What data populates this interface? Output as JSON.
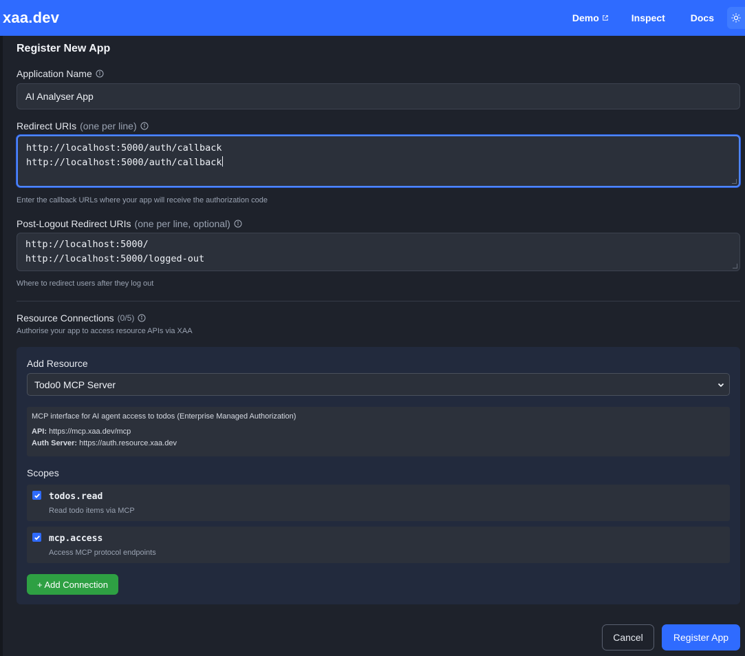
{
  "header": {
    "brand": "xaa.dev",
    "nav": [
      {
        "label": "Demo",
        "external": true
      },
      {
        "label": "Inspect"
      },
      {
        "label": "Docs"
      }
    ],
    "theme_toggle_icon": "sun-icon"
  },
  "form": {
    "title": "Register New App",
    "app_name": {
      "label": "Application Name",
      "value": "AI Analyser App"
    },
    "redirect_uris": {
      "label": "Redirect URIs",
      "hint": "(one per line)",
      "lines": [
        "http://localhost:5000/auth/callback",
        "http://localhost:5000/auth/callback"
      ],
      "help": "Enter the callback URLs where your app will receive the authorization code"
    },
    "post_logout": {
      "label": "Post-Logout Redirect URIs",
      "hint": "(one per line, optional)",
      "lines": [
        "http://localhost:5000/",
        "http://localhost:5000/logged-out"
      ],
      "help": "Where to redirect users after they log out"
    },
    "resources": {
      "label": "Resource Connections",
      "count": "(0/5)",
      "subtitle": "Authorise your app to access resource APIs via XAA",
      "add_resource_label": "Add Resource",
      "selected_resource": "Todo0 MCP Server",
      "description": "MCP interface for AI agent access to todos (Enterprise Managed Authorization)",
      "api_label": "API:",
      "api_value": "https://mcp.xaa.dev/mcp",
      "auth_label": "Auth Server:",
      "auth_value": "https://auth.resource.xaa.dev",
      "scopes_label": "Scopes",
      "scopes": [
        {
          "name": "todos.read",
          "description": "Read todo items via MCP",
          "checked": true
        },
        {
          "name": "mcp.access",
          "description": "Access MCP protocol endpoints",
          "checked": true
        }
      ],
      "add_connection_label": "+ Add Connection"
    },
    "cancel_label": "Cancel",
    "submit_label": "Register App"
  },
  "colors": {
    "primary": "#2f6bff",
    "background": "#1e222b",
    "success": "#2ea043"
  }
}
